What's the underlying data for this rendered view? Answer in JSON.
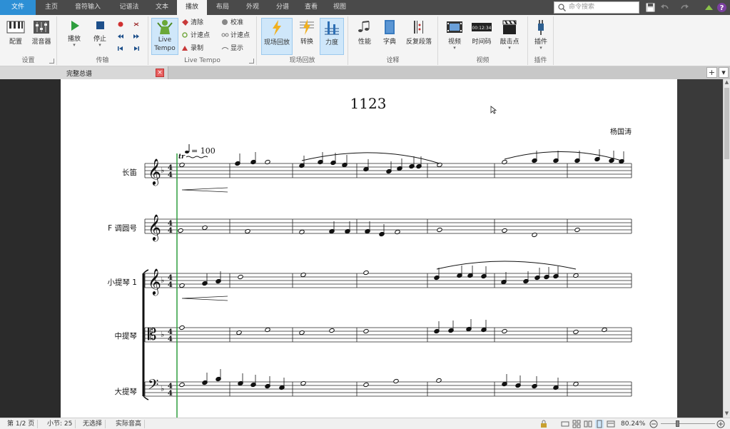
{
  "tabs": [
    {
      "label": "文件"
    },
    {
      "label": "主页"
    },
    {
      "label": "音符输入"
    },
    {
      "label": "记谱法"
    },
    {
      "label": "文本"
    },
    {
      "label": "播放"
    },
    {
      "label": "布局"
    },
    {
      "label": "外观"
    },
    {
      "label": "分谱"
    },
    {
      "label": "查看"
    },
    {
      "label": "视图"
    }
  ],
  "search": {
    "placeholder": "命令搜索"
  },
  "ribbon": {
    "groups": {
      "setup": "设置",
      "transport": "传输",
      "live_tempo": "Live Tempo",
      "live_playback": "现场回放",
      "interpretation": "诠释",
      "video": "视频",
      "plugins": "插件"
    },
    "buttons": {
      "config": "配置",
      "mixer": "混音器",
      "play": "播放",
      "stop": "停止",
      "live_tempo": "Live Tempo",
      "clear": "清除",
      "tap_point": "计速点",
      "record": "录制",
      "calibrate": "校准",
      "tap_point2": "计速点",
      "display": "显示",
      "live_playback": "现场回放",
      "convert": "转换",
      "dynamics": "力度",
      "performance": "性能",
      "dictionary": "字典",
      "repeats": "反复段落",
      "video": "视频",
      "timecode": "时间码",
      "timecode_text": "00:12:34",
      "hit_points": "敲击点",
      "plugins": "插件"
    }
  },
  "document": {
    "tab_title": "完整总谱",
    "close": "×"
  },
  "score": {
    "title": "1123",
    "composer": "杨国涛",
    "tempo": "= 100",
    "instruments": [
      "长笛",
      "F 调圆号",
      "小提琴 1",
      "中提琴",
      "大提琴"
    ]
  },
  "status": {
    "page": "第 1/2 页",
    "bars": "小节: 25",
    "selection": "无选择",
    "pitch": "实际音高",
    "zoom": "80.24%"
  },
  "colors": {
    "accent": "#2d8fd5",
    "playback_line": "#2e9e3e",
    "highlight": "#cfe7fa"
  }
}
